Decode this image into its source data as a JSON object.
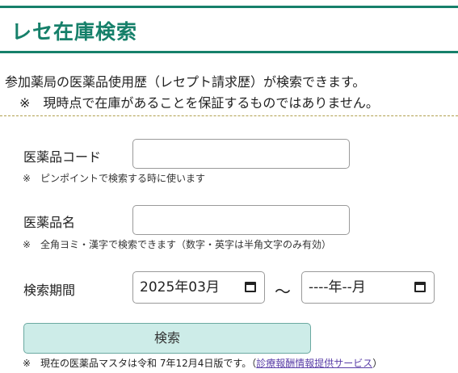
{
  "header": {
    "title": "レセ在庫検索"
  },
  "intro": {
    "description": "参加薬局の医薬品使用歴（レセプト請求歴）が検索できます。",
    "note": "※　現時点で在庫があることを保証するものではありません。"
  },
  "form": {
    "code": {
      "label": "医薬品コード",
      "value": "",
      "hint": "※　ピンポイントで検索する時に使います"
    },
    "name": {
      "label": "医薬品名",
      "value": "",
      "hint": "※　全角ヨミ・漢字で検索できます（数字・英字は半角文字のみ有効）"
    },
    "period": {
      "label": "検索期間",
      "from": "2025年03月",
      "separator": "～",
      "to": "----年--月"
    },
    "search_button": "検索"
  },
  "footer": {
    "note": "※　現在の医薬品マスタは令和 7年12月4日版です。（",
    "link": "診療報酬情報提供サービス",
    "close": "）"
  },
  "colors": {
    "accent": "#16806a",
    "button_bg": "#cdece8",
    "link": "#5b3fa8"
  }
}
